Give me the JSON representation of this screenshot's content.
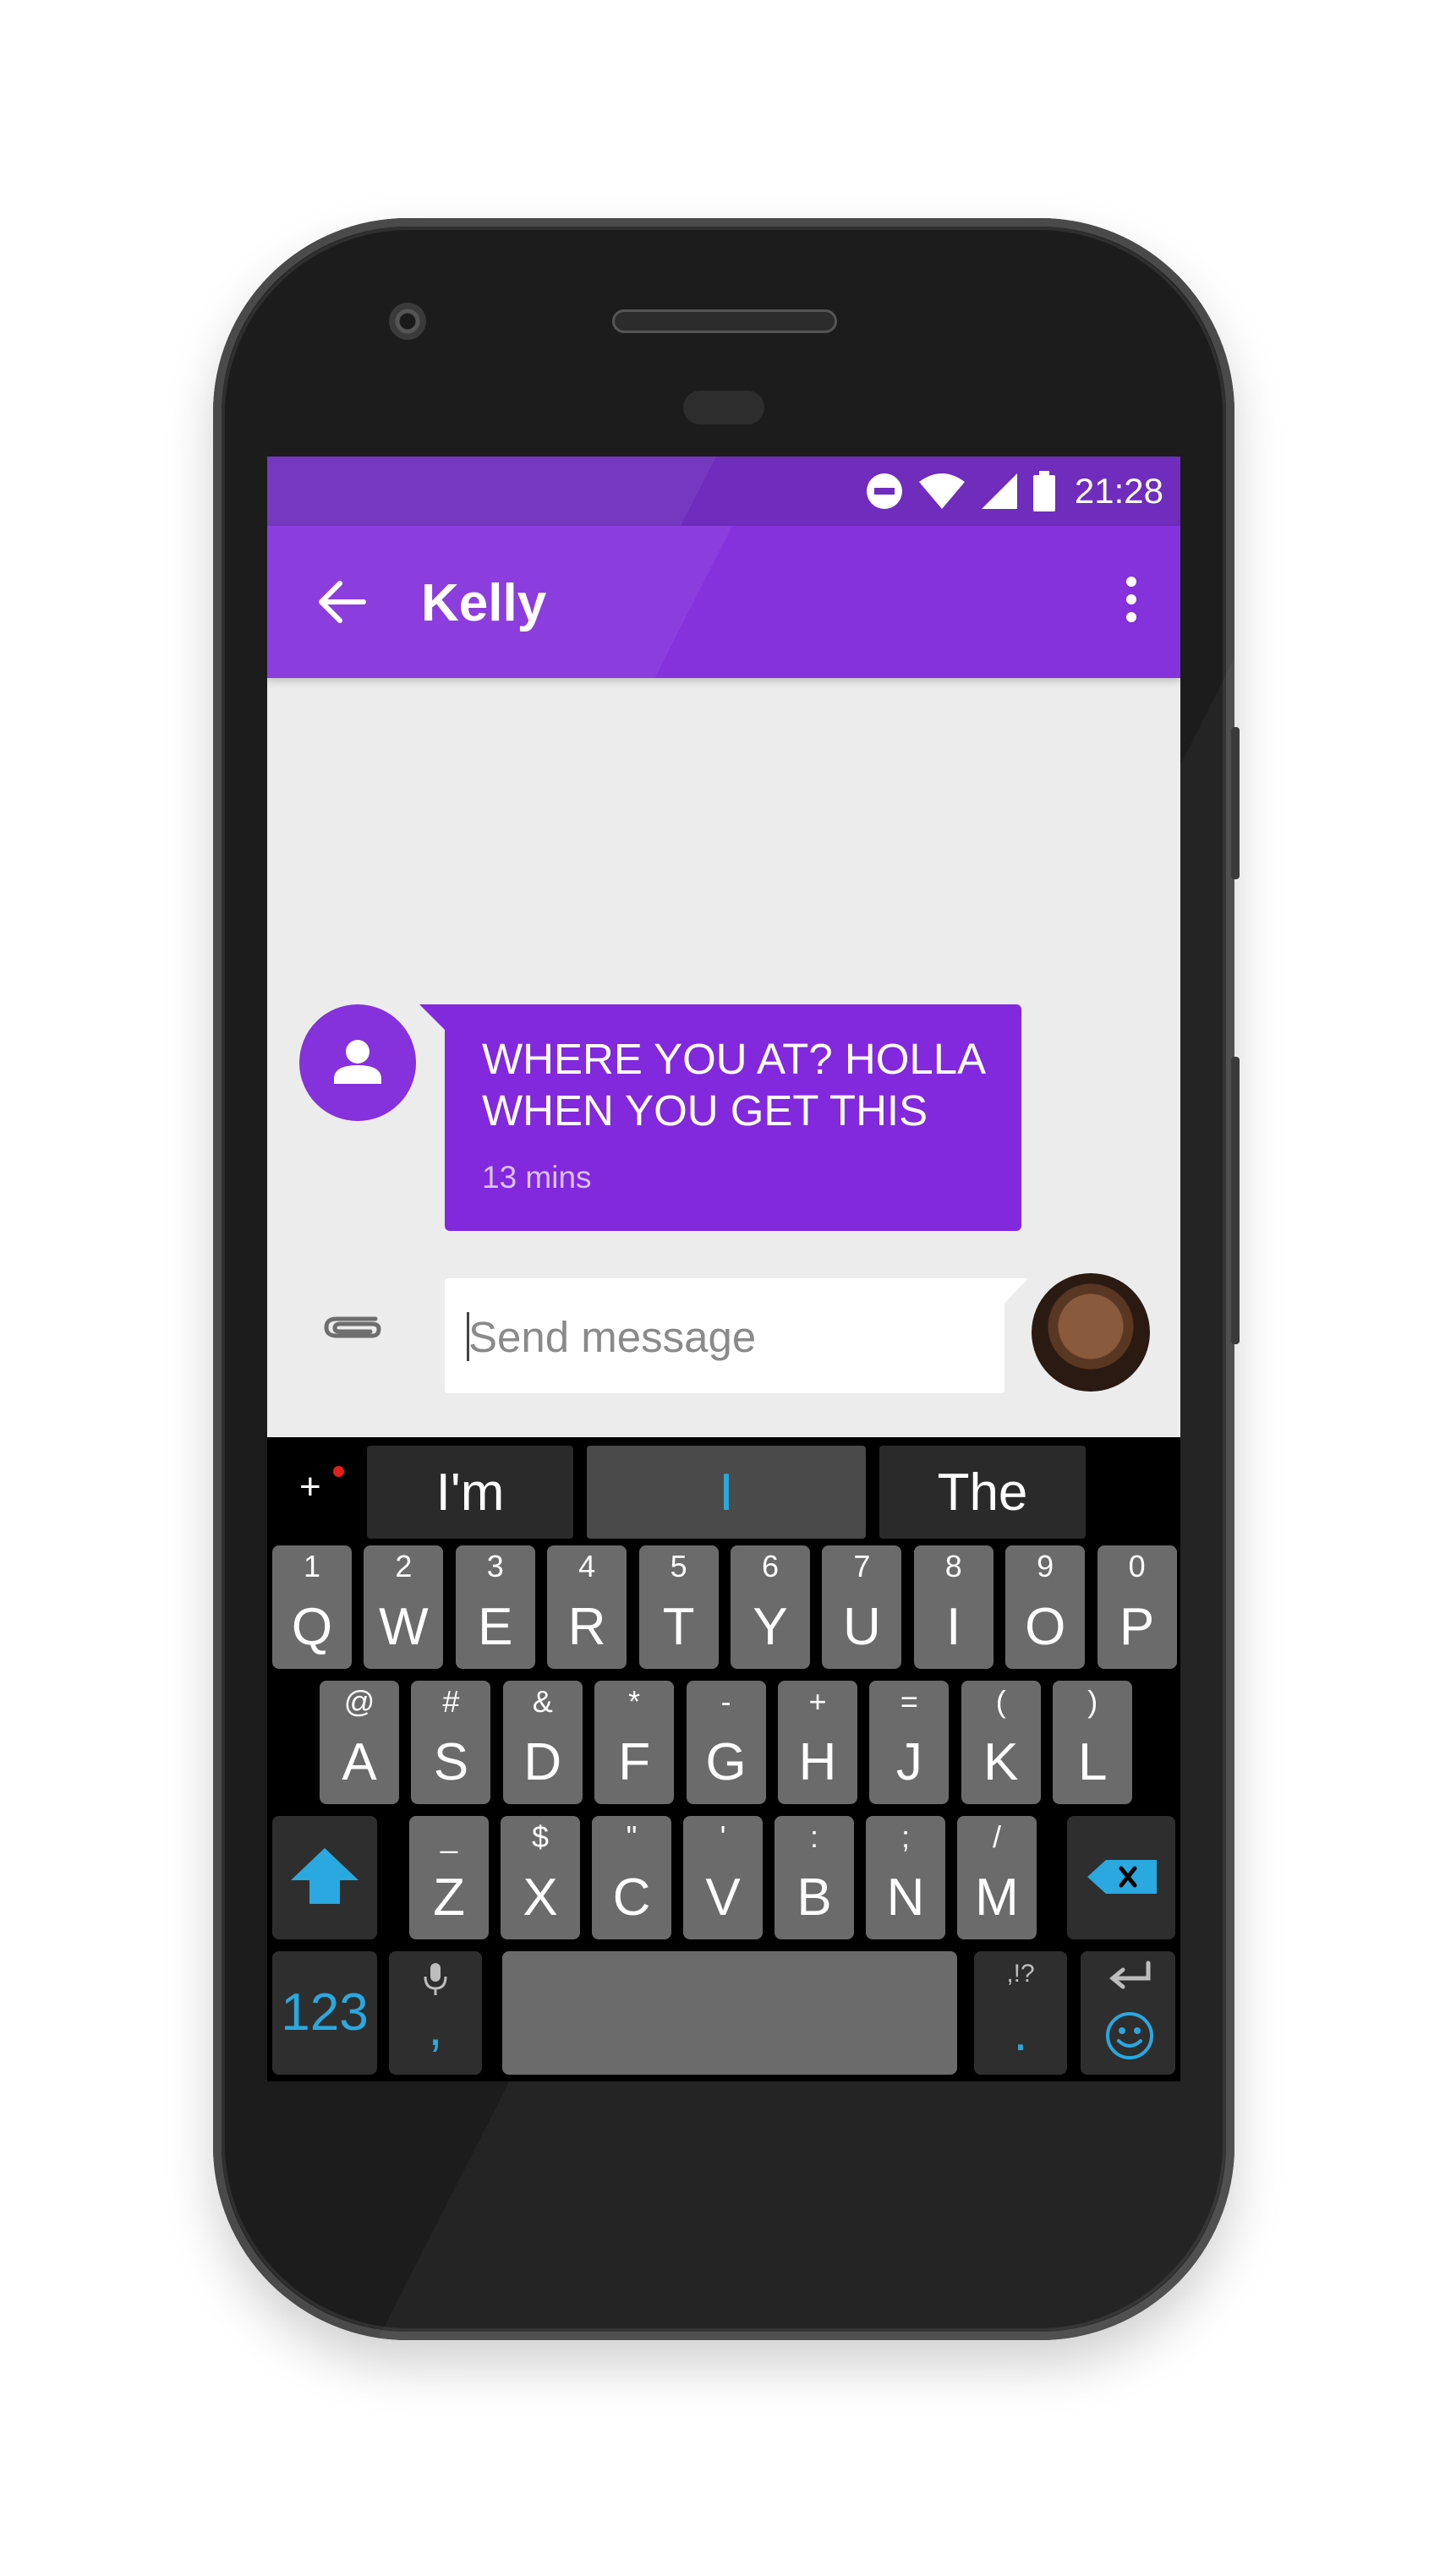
{
  "status_bar": {
    "time": "21:28"
  },
  "app_bar": {
    "title": "Kelly"
  },
  "message": {
    "text": "WHERE YOU AT? HOLLA WHEN YOU GET THIS",
    "time": "13 mins"
  },
  "composer": {
    "placeholder": "Send message"
  },
  "keyboard": {
    "suggestions": [
      "I'm",
      "I",
      "The"
    ],
    "row1": [
      {
        "main": "Q",
        "sub": "1"
      },
      {
        "main": "W",
        "sub": "2"
      },
      {
        "main": "E",
        "sub": "3"
      },
      {
        "main": "R",
        "sub": "4"
      },
      {
        "main": "T",
        "sub": "5"
      },
      {
        "main": "Y",
        "sub": "6"
      },
      {
        "main": "U",
        "sub": "7"
      },
      {
        "main": "I",
        "sub": "8"
      },
      {
        "main": "O",
        "sub": "9"
      },
      {
        "main": "P",
        "sub": "0"
      }
    ],
    "row2": [
      {
        "main": "A",
        "sub": "@"
      },
      {
        "main": "S",
        "sub": "#"
      },
      {
        "main": "D",
        "sub": "&"
      },
      {
        "main": "F",
        "sub": "*"
      },
      {
        "main": "G",
        "sub": "-"
      },
      {
        "main": "H",
        "sub": "+"
      },
      {
        "main": "J",
        "sub": "="
      },
      {
        "main": "K",
        "sub": "("
      },
      {
        "main": "L",
        "sub": ")"
      }
    ],
    "row3": [
      {
        "main": "Z",
        "sub": "_"
      },
      {
        "main": "X",
        "sub": "$"
      },
      {
        "main": "C",
        "sub": "\""
      },
      {
        "main": "V",
        "sub": "'"
      },
      {
        "main": "B",
        "sub": ":"
      },
      {
        "main": "N",
        "sub": ";"
      },
      {
        "main": "M",
        "sub": "/"
      }
    ],
    "numbers_key": "123",
    "comma_key": ",",
    "period_key": ".",
    "punct_hint": ",!?"
  },
  "colors": {
    "accent": "#8531dc",
    "status_bar": "#6f2cbd",
    "keyboard_accent": "#2aa8e0"
  }
}
